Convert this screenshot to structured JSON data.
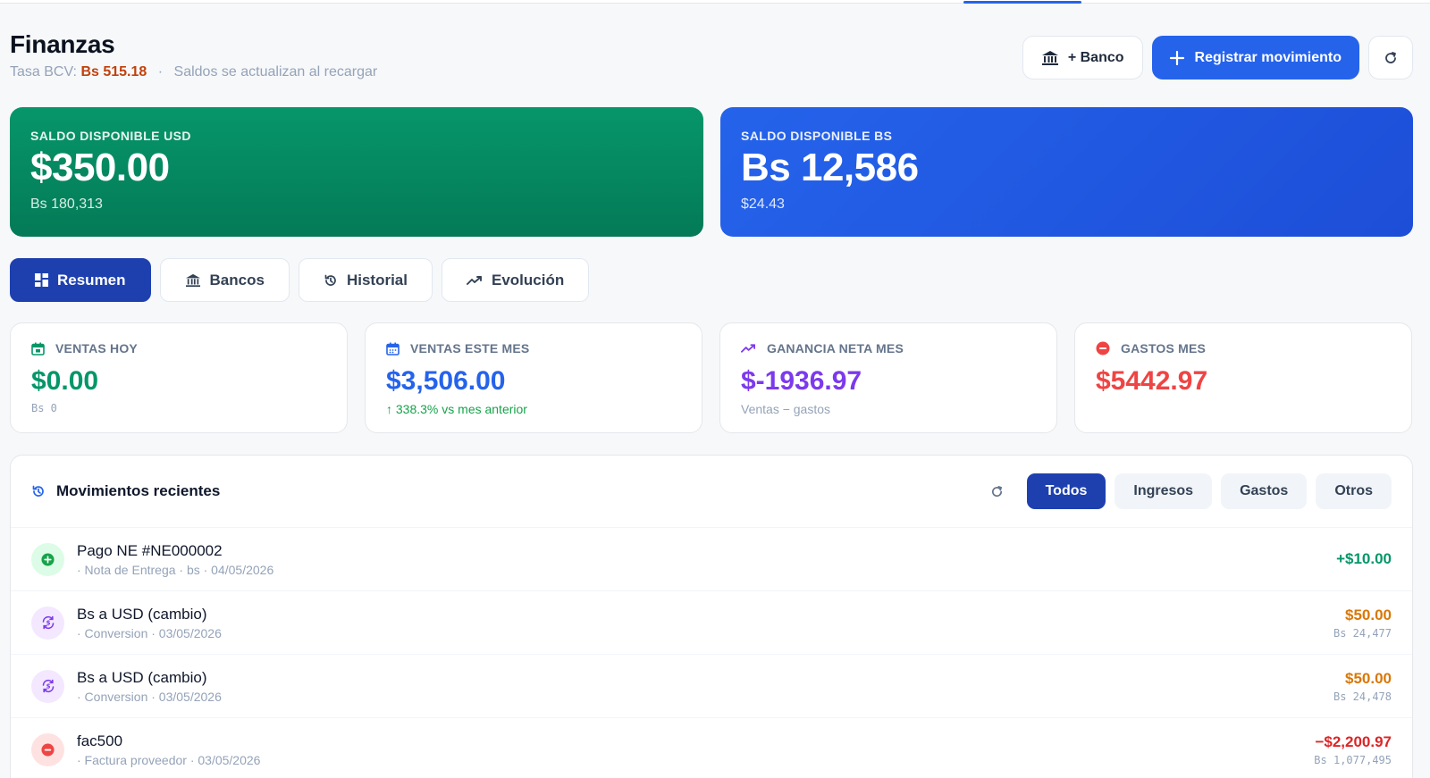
{
  "header": {
    "title": "Finanzas",
    "rate_label": "Tasa BCV:",
    "rate_value": "Bs 515.18",
    "rate_note": "Saldos se actualizan al recargar",
    "bank_button": "+ Banco",
    "register_button": "Registrar movimiento"
  },
  "balances": {
    "usd": {
      "label": "SALDO DISPONIBLE USD",
      "amount": "$350.00",
      "sub": "Bs 180,313"
    },
    "bs": {
      "label": "SALDO DISPONIBLE BS",
      "amount": "Bs 12,586",
      "sub": "$24.43"
    }
  },
  "tabs": [
    {
      "label": "Resumen",
      "active": true,
      "icon": "dashboard-icon"
    },
    {
      "label": "Bancos",
      "active": false,
      "icon": "bank-icon"
    },
    {
      "label": "Historial",
      "active": false,
      "icon": "history-icon"
    },
    {
      "label": "Evolución",
      "active": false,
      "icon": "trend-icon"
    }
  ],
  "stats": [
    {
      "label": "VENTAS HOY",
      "amount": "$0.00",
      "sub": "Bs 0",
      "color": "#059669",
      "icon": "calendar-check-icon"
    },
    {
      "label": "VENTAS ESTE MES",
      "amount": "$3,506.00",
      "sub": "↑ 338.3% vs mes anterior",
      "color": "#2563eb",
      "sub_color": "#16a34a",
      "icon": "calendar-icon"
    },
    {
      "label": "GANANCIA NETA MES",
      "amount": "$-1936.97",
      "sub": "Ventas − gastos",
      "color": "#7c3aed",
      "icon": "trend-icon"
    },
    {
      "label": "GASTOS MES",
      "amount": "$5442.97",
      "sub": "",
      "color": "#ef4444",
      "icon": "minus-circle-icon"
    }
  ],
  "movements": {
    "title": "Movimientos recientes",
    "filters": [
      {
        "label": "Todos",
        "active": true
      },
      {
        "label": "Ingresos",
        "active": false
      },
      {
        "label": "Gastos",
        "active": false
      },
      {
        "label": "Otros",
        "active": false
      }
    ],
    "rows": [
      {
        "title": "Pago NE #NE000002",
        "sub": "· Nota de Entrega · bs · 04/05/2026",
        "amount": "+$10.00",
        "amount_bs": "",
        "type": "income",
        "color": "#059669"
      },
      {
        "title": "Bs a USD (cambio)",
        "sub": "· Conversion · 03/05/2026",
        "amount": "$50.00",
        "amount_bs": "Bs 24,477",
        "type": "exchange",
        "color": "#d97706"
      },
      {
        "title": "Bs a USD (cambio)",
        "sub": "· Conversion · 03/05/2026",
        "amount": "$50.00",
        "amount_bs": "Bs 24,478",
        "type": "exchange",
        "color": "#d97706"
      },
      {
        "title": "fac500",
        "sub": "· Factura proveedor · 03/05/2026",
        "amount": "−$2,200.97",
        "amount_bs": "Bs 1,077,495",
        "type": "expense",
        "color": "#dc2626"
      }
    ]
  }
}
